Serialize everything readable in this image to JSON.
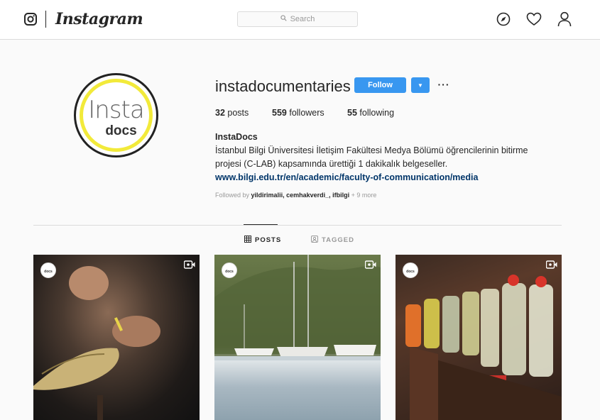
{
  "nav": {
    "wordmark": "Instagram",
    "search_placeholder": "Search",
    "icons": [
      "instagram-icon",
      "explore-compass-icon",
      "heart-icon",
      "profile-icon"
    ]
  },
  "profile": {
    "username": "instadocumentaries",
    "follow_label": "Follow",
    "more_label": "···",
    "avatar": {
      "top_text": "Insta",
      "bottom_text": "docs",
      "ring_color": "#f2ea3a"
    },
    "stats": {
      "posts_count": "32",
      "posts_label": "posts",
      "followers_count": "559",
      "followers_label": "followers",
      "following_count": "55",
      "following_label": "following"
    },
    "bio": {
      "name": "InstaDocs",
      "text": "İstanbul Bilgi Üniversitesi İletişim Fakültesi Medya Bölümü öğrencilerinin bitirme projesi (C-LAB) kapsamında ürettiği 1 dakikalık belgeseller.",
      "link": "www.bilgi.edu.tr/en/academic/faculty-of-communication/media"
    },
    "followed_by": {
      "prefix": "Followed by",
      "names": "yildirimalii, cemhakverdi_, ifbilgi",
      "more": "+ 9 more"
    }
  },
  "tabs": [
    {
      "label": "POSTS",
      "active": true
    },
    {
      "label": "TAGGED",
      "active": false
    }
  ],
  "posts": [
    {
      "badge": "docs",
      "type": "video"
    },
    {
      "badge": "docs",
      "type": "video"
    },
    {
      "badge": "docs",
      "type": "video"
    }
  ],
  "colors": {
    "accent": "#3897f0",
    "link": "#003569",
    "border": "#dbdbdb"
  }
}
